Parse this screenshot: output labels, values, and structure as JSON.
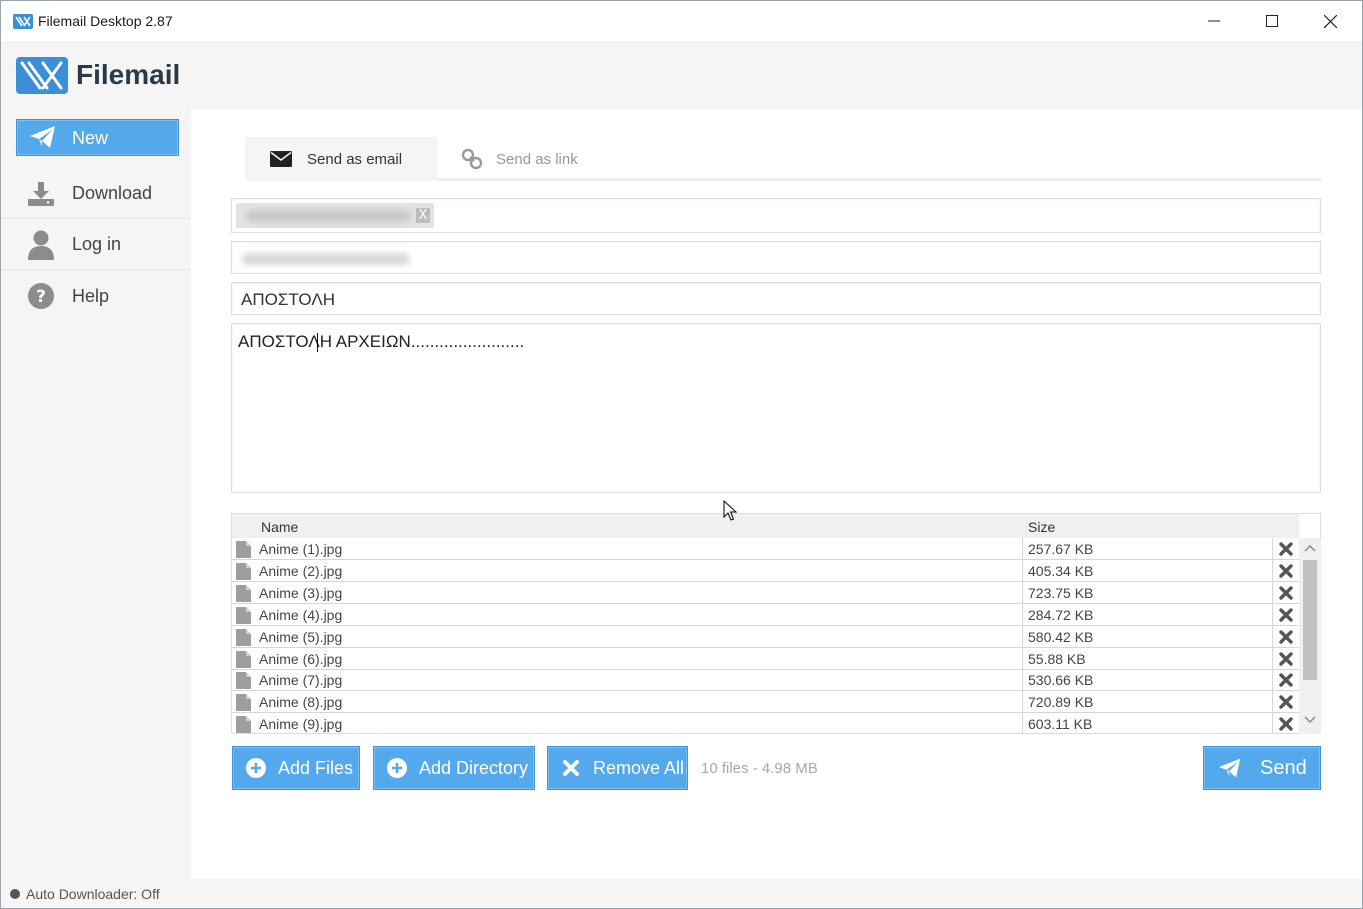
{
  "window": {
    "title": "Filemail Desktop 2.87",
    "controls": [
      "minimize-icon",
      "maximize-icon",
      "close-icon"
    ]
  },
  "brand": {
    "logo_text": "Filemail",
    "accent_color": "#54a8ec"
  },
  "sidebar": {
    "items": [
      {
        "label": "New",
        "icon": "paper-plane-icon",
        "active": true
      },
      {
        "label": "Download",
        "icon": "download-icon"
      },
      {
        "label": "Log in",
        "icon": "user-icon"
      },
      {
        "label": "Help",
        "icon": "question-circle-icon"
      }
    ]
  },
  "tabs": [
    {
      "label": "Send as email",
      "icon": "envelope-icon",
      "active": true
    },
    {
      "label": "Send as link",
      "icon": "link-icon",
      "active": false
    }
  ],
  "form": {
    "to_chip_close": "X",
    "subject": "ΑΠΟΣΤΟΛΗ",
    "message": "ΑΠΟΣΤΟΛΗ ΑΡΧΕΙΩΝ........................"
  },
  "files": {
    "columns": {
      "name": "Name",
      "size": "Size"
    },
    "rows": [
      {
        "name": "Anime (1).jpg",
        "size": "257.67 KB"
      },
      {
        "name": "Anime (2).jpg",
        "size": "405.34 KB"
      },
      {
        "name": "Anime (3).jpg",
        "size": "723.75 KB"
      },
      {
        "name": "Anime (4).jpg",
        "size": "284.72 KB"
      },
      {
        "name": "Anime (5).jpg",
        "size": "580.42 KB"
      },
      {
        "name": "Anime (6).jpg",
        "size": "55.88 KB"
      },
      {
        "name": "Anime (7).jpg",
        "size": "530.66 KB"
      },
      {
        "name": "Anime (8).jpg",
        "size": "720.89 KB"
      },
      {
        "name": "Anime (9).jpg",
        "size": "603.11 KB"
      }
    ]
  },
  "actions": {
    "add_files": "Add Files",
    "add_directory": "Add Directory",
    "remove_all": "Remove All",
    "summary": "10 files - 4.98 MB",
    "send": "Send"
  },
  "status": {
    "auto_downloader": "Auto Downloader: Off"
  }
}
